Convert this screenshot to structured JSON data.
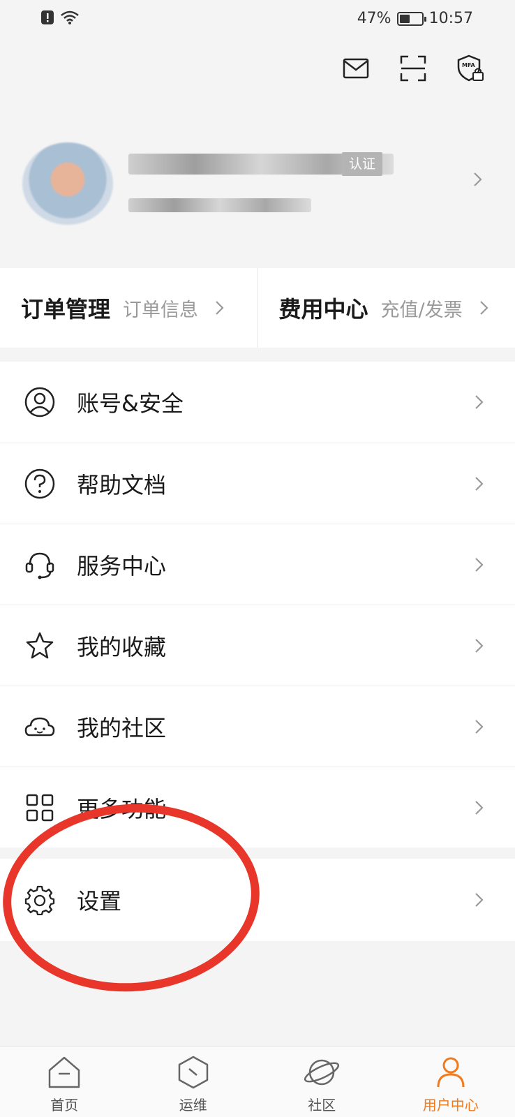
{
  "status_bar": {
    "battery": "47%",
    "battery_level": 0.47,
    "time": "10:57"
  },
  "profile": {
    "verify_badge": "认证"
  },
  "quick": [
    {
      "title": "订单管理",
      "sub": "订单信息"
    },
    {
      "title": "费用中心",
      "sub": "充值/发票"
    }
  ],
  "menu": [
    {
      "label": "账号&安全",
      "icon": "user-circle-icon"
    },
    {
      "label": "帮助文档",
      "icon": "question-circle-icon"
    },
    {
      "label": "服务中心",
      "icon": "headset-icon"
    },
    {
      "label": "我的收藏",
      "icon": "star-icon"
    },
    {
      "label": "我的社区",
      "icon": "cloud-face-icon"
    },
    {
      "label": "更多功能",
      "icon": "grid-icon"
    }
  ],
  "settings": {
    "label": "设置",
    "icon": "gear-icon"
  },
  "tabs": [
    {
      "label": "首页",
      "icon": "home-icon"
    },
    {
      "label": "运维",
      "icon": "hexagon-icon"
    },
    {
      "label": "社区",
      "icon": "planet-icon"
    },
    {
      "label": "用户中心",
      "icon": "user-icon"
    }
  ],
  "colors": {
    "accent": "#f07a1e",
    "highlight": "#e8372a"
  }
}
